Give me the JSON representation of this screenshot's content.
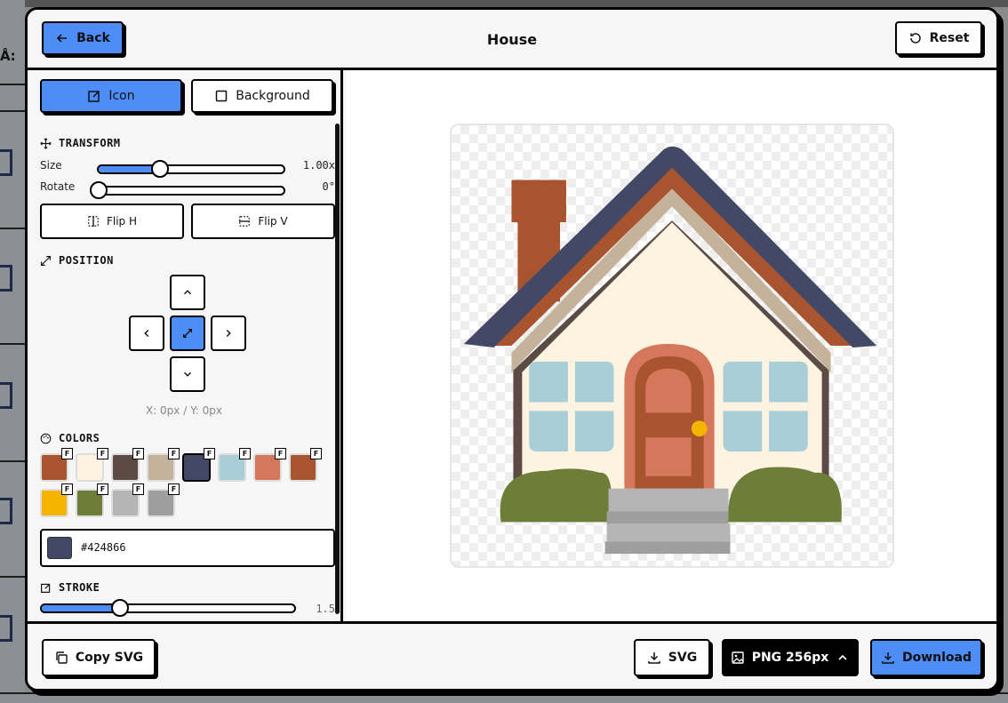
{
  "header": {
    "title": "House",
    "back_label": "Back",
    "reset_label": "Reset"
  },
  "backdrop": {
    "label": "Å:"
  },
  "tabs": {
    "icon_label": "Icon",
    "background_label": "Background",
    "active": "Icon"
  },
  "transform": {
    "section_label": "TRANSFORM",
    "size_label": "Size",
    "size_value": "1.00x",
    "size_fraction": 0.33,
    "rotate_label": "Rotate",
    "rotate_value": "0°",
    "rotate_fraction": 0.0,
    "flip_h_label": "Flip H",
    "flip_v_label": "Flip V"
  },
  "position": {
    "section_label": "POSITION",
    "coords_text": "X: 0px / Y: 0px"
  },
  "colors": {
    "section_label": "COLORS",
    "badge": "F",
    "swatches": [
      "#a8552f",
      "#fdf3e1",
      "#5c4a44",
      "#c4b29a",
      "#424866",
      "#a8ced8",
      "#d4775a",
      "#a8552f",
      "#f5b400",
      "#6e7d37",
      "#b5b5b5",
      "#9e9e9e"
    ],
    "selected_index": 4,
    "selected_hex": "#424866"
  },
  "stroke": {
    "section_label": "STROKE",
    "value": "1.5",
    "fraction": 0.31
  },
  "footer": {
    "copy_svg_label": "Copy SVG",
    "svg_label": "SVG",
    "png_label": "PNG 256px",
    "download_label": "Download"
  },
  "colors_theme": {
    "accent": "#4e8df7",
    "border": "#000000",
    "panel_bg": "#f6f6f6"
  }
}
